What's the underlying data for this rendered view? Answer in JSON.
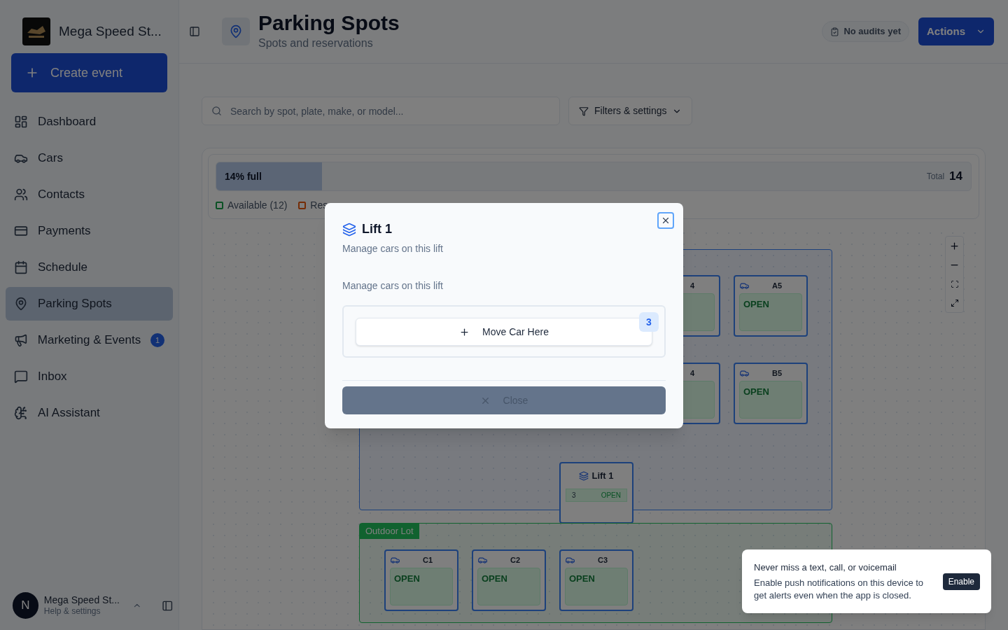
{
  "sidebar": {
    "brand": "Mega Speed St...",
    "create_button": "Create event",
    "items": [
      {
        "label": "Dashboard",
        "selected": false
      },
      {
        "label": "Cars",
        "selected": false
      },
      {
        "label": "Contacts",
        "selected": false
      },
      {
        "label": "Payments",
        "selected": false
      },
      {
        "label": "Schedule",
        "selected": false
      },
      {
        "label": "Parking Spots",
        "selected": true
      },
      {
        "label": "Marketing & Events",
        "selected": false,
        "badge": "1"
      },
      {
        "label": "Inbox",
        "selected": false
      },
      {
        "label": "AI Assistant",
        "selected": false
      }
    ],
    "footer": {
      "avatar": "N",
      "name": "Mega Speed St...",
      "subtitle": "Help & settings"
    }
  },
  "header": {
    "title": "Parking Spots",
    "subtitle": "Spots and reservations",
    "audit_badge": "No audits yet",
    "actions_button": "Actions"
  },
  "toolbar": {
    "search": {
      "placeholder": "Search by spot, plate, make, or model..."
    },
    "filters_button": "Filters & settings"
  },
  "occupancy": {
    "label": "14% full",
    "level": 0.14,
    "total_label": "Total",
    "total": "14",
    "legend": [
      {
        "label": "Available (12)",
        "kind": "available"
      },
      {
        "label": "Res",
        "kind": "reserved"
      }
    ]
  },
  "map": {
    "zones": [
      {
        "kind": "garage",
        "items": [
          {
            "kind": "spot",
            "label": "4"
          },
          {
            "kind": "spot",
            "label": "A5",
            "status": "OPEN"
          },
          {
            "kind": "spot",
            "label": "4"
          },
          {
            "kind": "spot",
            "label": "B5",
            "status": "OPEN"
          },
          {
            "kind": "lift",
            "label": "Lift 1",
            "count": "3",
            "status": "OPEN"
          }
        ]
      },
      {
        "label": "Outdoor Lot",
        "kind": "outdoor",
        "items": [
          {
            "kind": "spot",
            "label": "C1",
            "status": "OPEN"
          },
          {
            "kind": "spot",
            "label": "C2",
            "status": "OPEN"
          },
          {
            "kind": "spot",
            "label": "C3",
            "status": "OPEN"
          }
        ]
      }
    ]
  },
  "dialog": {
    "title": "Lift 1",
    "description": "Manage cars on this lift",
    "section_label": "Manage cars on this lift",
    "move_button": "Move Car Here",
    "count_badge": "3",
    "close_button": "Close"
  },
  "toast": {
    "title": "Never miss a text, call, or voicemail",
    "body": "Enable push notifications on this device to get alerts even when the app is closed.",
    "button": "Enable"
  }
}
